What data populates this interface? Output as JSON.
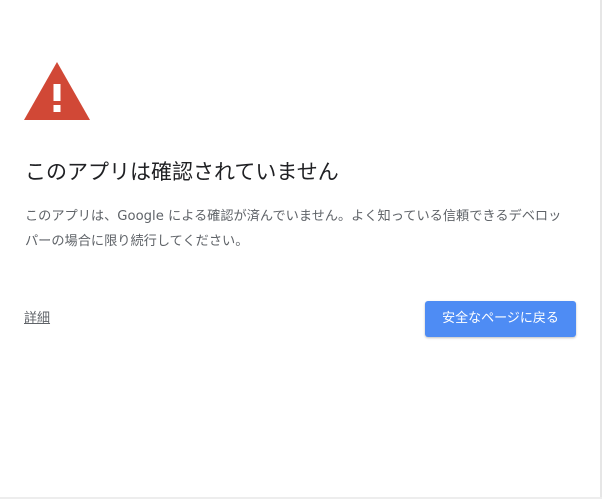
{
  "interstitial": {
    "icon": "warning-triangle-icon",
    "icon_color": "#d14836",
    "title": "このアプリは確認されていません",
    "description": "このアプリは、Google による確認が済んでいません。よく知っている信頼できるデベロッパーの場合に限り続行してください。",
    "details_link": "詳細",
    "back_button": "安全なページに戻る",
    "back_button_color": "#4e8cf4"
  }
}
